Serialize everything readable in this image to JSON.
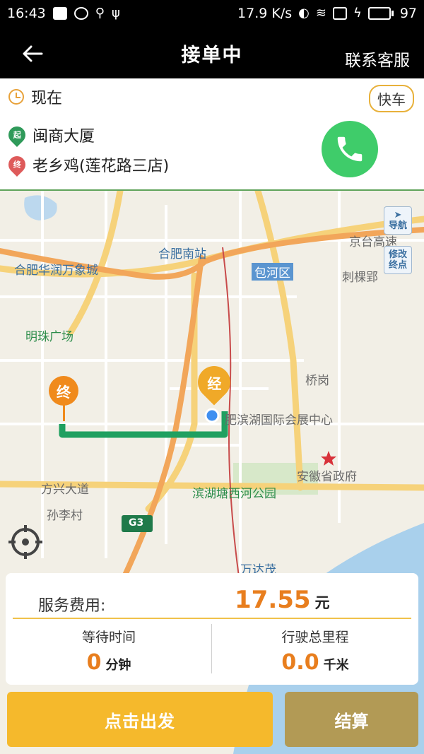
{
  "status_bar": {
    "time": "16:43",
    "net_speed": "17.9 K/s",
    "battery": "97",
    "battery_level": 0.97
  },
  "header": {
    "title": "接单中",
    "contact": "联系客服"
  },
  "order": {
    "time_label": "现在",
    "car_type": "快车",
    "start_badge": "起",
    "start": "闽商大厦",
    "end_badge": "终",
    "end": "老乡鸡(莲花路三店)"
  },
  "map": {
    "labels": {
      "hefei_south_station": "合肥南站",
      "jingtai_highway": "京台高速",
      "huarun": "合肥华润万象城",
      "baohe": "包河区",
      "ciliuying": "刺棵郢",
      "mingzhu": "明珠广场",
      "qiaogang": "桥岗",
      "expo": "肥滨湖国际会展中心",
      "fangxing": "方兴大道",
      "anhui_gov": "安徽省政府",
      "binhu_park": "滨湖塘西河公园",
      "sunli": "孙李村",
      "g3": "G3",
      "wanda": "万达茂"
    },
    "nav_button": "导航",
    "edit_end_button": "修改终点",
    "marker_end": "终",
    "marker_via": "经"
  },
  "fee": {
    "label": "服务费用:",
    "amount": "17.55",
    "unit": "元",
    "wait_label": "等待时间",
    "wait_value": "0",
    "wait_unit": "分钟",
    "distance_label": "行驶总里程",
    "distance_value": "0.0",
    "distance_unit": "千米"
  },
  "actions": {
    "depart": "点击出发",
    "settle": "结算"
  }
}
